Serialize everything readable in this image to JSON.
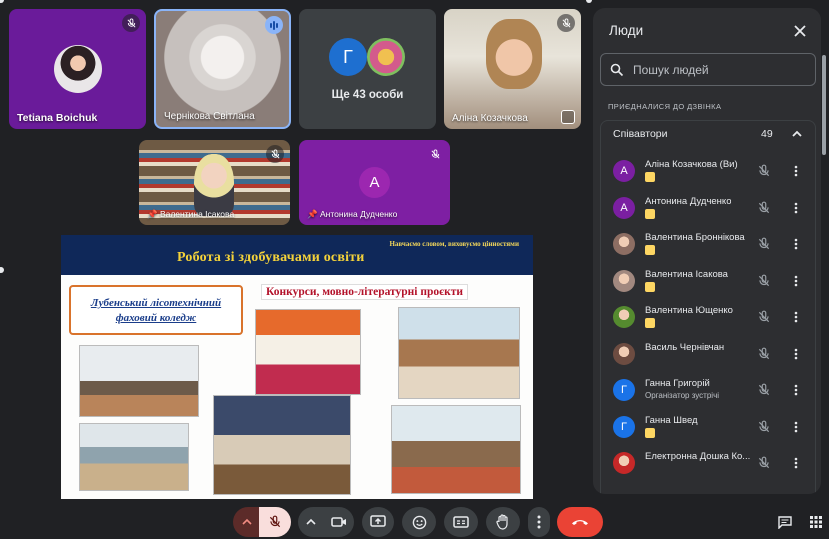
{
  "tiles": {
    "tetiana": {
      "name": "Tetiana Boichuk",
      "mic": "mic-off"
    },
    "chernikova": {
      "name": "Чернікова Світлана",
      "mic": "speaking"
    },
    "more": {
      "letter": "Г",
      "label": "Ще 43 особи"
    },
    "alina": {
      "name": "Аліна Козачкова",
      "mic": "mic-off"
    },
    "valentyna": {
      "name": "Валентина Ісакова",
      "mic": "mic-off"
    },
    "antonina": {
      "name": "Антонина Дудченко",
      "letter": "А",
      "mic": "mic-off"
    }
  },
  "people_panel": {
    "title": "Люди",
    "search_placeholder": "Пошук людей",
    "joined_label": "ПРИЄДНАЛИСЯ ДО ДЗВІНКА",
    "group_title": "Співавтори",
    "group_count": "49",
    "people": [
      {
        "name": "Аліна Козачкова (Ви)",
        "letter": "А",
        "color": "#7b1fa2",
        "badge": true
      },
      {
        "name": "Антонина Дудченко",
        "letter": "А",
        "color": "#7b1fa2",
        "badge": true
      },
      {
        "name": "Валентина Броннікова",
        "letter": "",
        "color": "#8d6e63",
        "badge": true
      },
      {
        "name": "Валентина Ісакова",
        "letter": "",
        "color": "#a1887f",
        "badge": true
      },
      {
        "name": "Валентина Ющенко",
        "letter": "",
        "color": "#558b2f",
        "badge": true
      },
      {
        "name": "Василь Чернівчан",
        "letter": "",
        "color": "#6d4c41",
        "badge": false
      },
      {
        "name": "Ганна Григорій",
        "letter": "Г",
        "color": "#1a73e8",
        "sub": "Організатор зустрічі"
      },
      {
        "name": "Ганна Швед",
        "letter": "Г",
        "color": "#1a73e8",
        "badge": true
      },
      {
        "name": "Електронна Дошка Ко...",
        "letter": "",
        "color": "#c62828",
        "badge": false
      }
    ]
  },
  "slide": {
    "motto": "Навчаємо словом, виховуємо цінностями",
    "title": "Робота зі здобувачами освіти",
    "college_line1": "Лубенський лісотехнічний",
    "college_line2": "фаховий коледж",
    "section": "Конкурси, мовно-літературні проєкти"
  },
  "colors": {
    "panel_bg": "#2d2e31",
    "page_bg": "#202124",
    "end_call": "#ea4335",
    "accent": "#8ab4f8"
  }
}
